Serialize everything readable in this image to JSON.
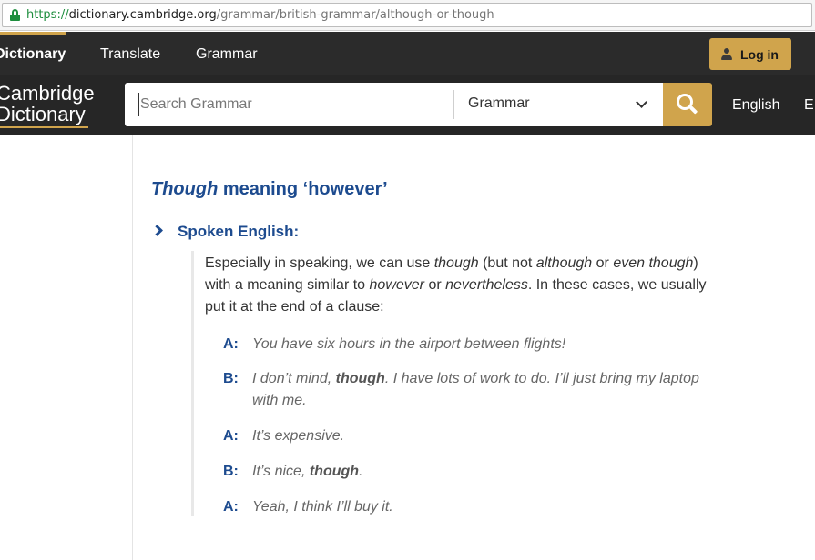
{
  "browser": {
    "url_scheme": "https://",
    "url_host": "dictionary.cambridge.org",
    "url_path": "/grammar/british-grammar/although-or-though"
  },
  "topnav": {
    "items": [
      {
        "label": "Dictionary"
      },
      {
        "label": "Translate"
      },
      {
        "label": "Grammar"
      }
    ],
    "login_label": "Log in",
    "accent_color": "#d0a44c"
  },
  "header": {
    "logo_line1": "Cambridge",
    "logo_line2": "Dictionary",
    "search_placeholder": "Search Grammar",
    "search_select": "Grammar",
    "language": "English",
    "language2": "E"
  },
  "article": {
    "heading_em": "Though",
    "heading_rest": " meaning ‘however’",
    "subheading": "Spoken English:",
    "para": [
      {
        "t": "Especially in speaking, we can use ",
        "i": false
      },
      {
        "t": "though",
        "i": true
      },
      {
        "t": " (but not ",
        "i": false
      },
      {
        "t": "although",
        "i": true
      },
      {
        "t": " or ",
        "i": false
      },
      {
        "t": "even though",
        "i": true
      },
      {
        "t": ") with a meaning similar to ",
        "i": false
      },
      {
        "t": "however",
        "i": true
      },
      {
        "t": " or ",
        "i": false
      },
      {
        "t": "nevertheless",
        "i": true
      },
      {
        "t": ". In these cases, we usually put it at the end of a clause:",
        "i": false
      }
    ],
    "dialogue": [
      {
        "speaker": "A:",
        "parts": [
          {
            "t": "You have six hours in the airport between flights!",
            "b": false
          }
        ]
      },
      {
        "speaker": "B:",
        "parts": [
          {
            "t": "I don’t mind, ",
            "b": false
          },
          {
            "t": "though",
            "b": true
          },
          {
            "t": ". I have lots of work to do. I’ll just bring my laptop with me.",
            "b": false
          }
        ]
      },
      {
        "speaker": "A:",
        "parts": [
          {
            "t": "It’s expensive.",
            "b": false
          }
        ]
      },
      {
        "speaker": "B:",
        "parts": [
          {
            "t": "It’s nice, ",
            "b": false
          },
          {
            "t": "though",
            "b": true
          },
          {
            "t": ".",
            "b": false
          }
        ]
      },
      {
        "speaker": "A:",
        "parts": [
          {
            "t": "Yeah, I think I’ll buy it.",
            "b": false
          }
        ]
      }
    ]
  }
}
